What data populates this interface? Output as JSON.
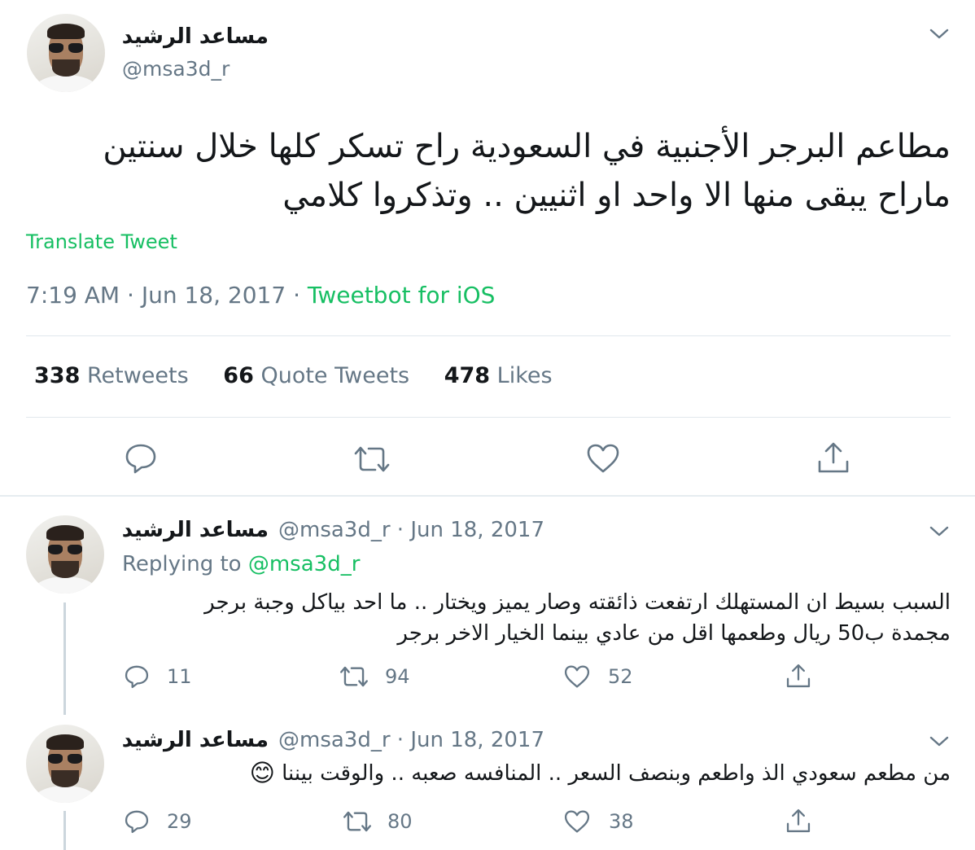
{
  "main_tweet": {
    "author_name": "مساعد الرشيد",
    "handle": "@msa3d_r",
    "text_line1": "مطاعم البرجر الأجنبية في السعودية راح تسكر كلها خلال سنتين",
    "text_line2": "ماراح يبقى منها الا واحد او اثنيين .. وتذكروا كلامي",
    "translate_label": "Translate Tweet",
    "time": "7:19 AM",
    "separator": "·",
    "date": "Jun 18, 2017",
    "source": "Tweetbot for iOS",
    "retweets_count": "338",
    "retweets_label": "Retweets",
    "quotes_count": "66",
    "quotes_label": "Quote Tweets",
    "likes_count": "478",
    "likes_label": "Likes"
  },
  "replies": [
    {
      "author_name": "مساعد الرشيد",
      "handle_date": "@msa3d_r · Jun 18, 2017",
      "replying_prefix": "Replying to",
      "replying_handle": "@msa3d_r",
      "text_line1": "السبب بسيط ان المستهلك ارتفعت ذائقته وصار يميز ويختار .. ما احد بياكل وجبة برجر",
      "text_line2": "مجمدة ب50 ريال وطعمها اقل من عادي بينما الخيار الاخر برجر",
      "reply_count": "11",
      "retweet_count": "94",
      "like_count": "52"
    },
    {
      "author_name": "مساعد الرشيد",
      "handle_date": "@msa3d_r · Jun 18, 2017",
      "text_line1": "من مطعم سعودي الذ واطعم وبنصف السعر .. المنافسه صعبه .. والوقت بيننا",
      "emoji": "😊",
      "reply_count": "29",
      "retweet_count": "80",
      "like_count": "38"
    }
  ],
  "colors": {
    "accent_green": "#17bf63",
    "secondary_text": "#657786",
    "divider": "#e1e8ed"
  },
  "icons": [
    "chevron-down-icon",
    "reply-icon",
    "retweet-icon",
    "like-icon",
    "share-icon"
  ]
}
